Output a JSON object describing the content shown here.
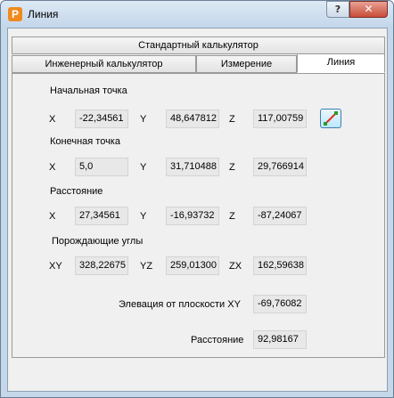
{
  "window": {
    "title": "Линия",
    "app_icon": "P",
    "help": "?",
    "close": "✕"
  },
  "tabs": {
    "standard": "Стандартный калькулятор",
    "engineering": "Инженерный калькулятор",
    "measurement": "Измерение",
    "line": "Линия"
  },
  "start_point": {
    "heading": "Начальная точка",
    "x_label": "X",
    "y_label": "Y",
    "z_label": "Z",
    "x": "-22,34561",
    "y": "48,647812",
    "z": "117,00759"
  },
  "end_point": {
    "heading": "Конечная точка",
    "x_label": "X",
    "y_label": "Y",
    "z_label": "Z",
    "x": "5,0",
    "y": "31,710488",
    "z": "29,766914"
  },
  "distance_vec": {
    "heading": "Расстояние",
    "x_label": "X",
    "y_label": "Y",
    "z_label": "Z",
    "x": "27,34561",
    "y": "-16,93732",
    "z": "-87,24067"
  },
  "angles": {
    "heading": "Порождающие углы",
    "xy_label": "XY",
    "yz_label": "YZ",
    "zx_label": "ZX",
    "xy": "328,22675",
    "yz": "259,01300",
    "zx": "162,59638"
  },
  "elevation": {
    "label": "Элевация от плоскости XY",
    "value": "-69,76082"
  },
  "distance": {
    "label": "Расстояние",
    "value": "92,98167"
  },
  "icons": {
    "pick_button": "pick-line-icon",
    "pick_color_a": "#e0301e",
    "pick_color_b": "#2a9a2a"
  }
}
